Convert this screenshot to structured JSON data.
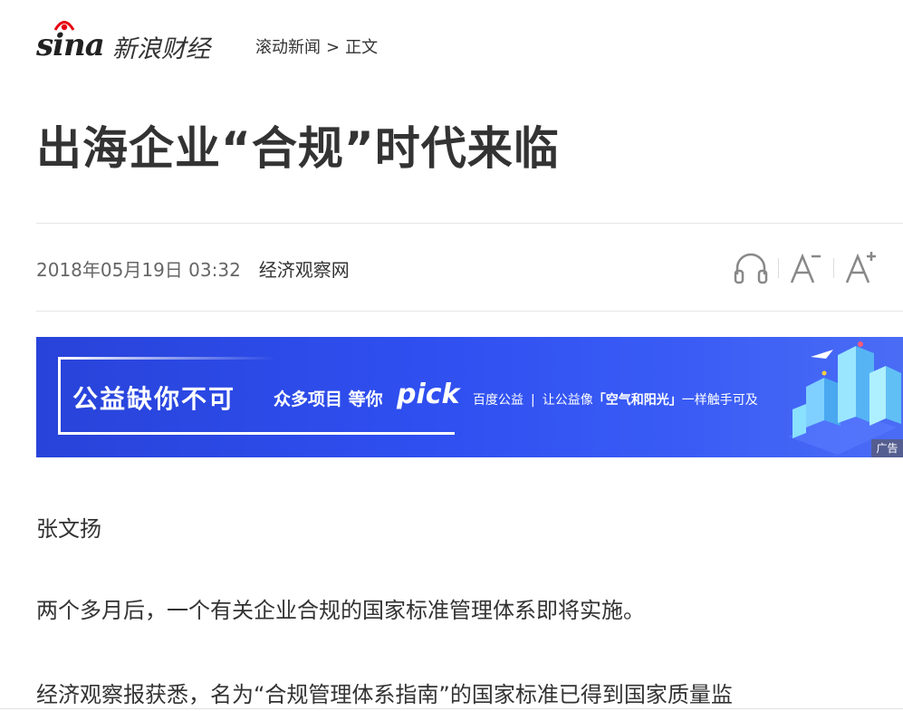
{
  "header": {
    "logo_text": "sina",
    "brand": "新浪财经",
    "breadcrumb": {
      "section": "滚动新闻",
      "separator": ">",
      "current": "正文"
    }
  },
  "article": {
    "title": "出海企业“合规”时代来临",
    "date": "2018年05月19日 03:32",
    "source": "经济观察网",
    "author": "张文扬",
    "paragraphs": [
      "两个多月后，一个有关企业合规的国家标准管理体系即将实施。",
      "经济观察报获悉，名为“合规管理体系指南”的国家标准已得到国家质量监"
    ]
  },
  "tools": [
    {
      "name": "listen",
      "icon": "headphones-icon"
    },
    {
      "name": "font-decrease",
      "icon": "font-decrease-icon"
    },
    {
      "name": "font-increase",
      "icon": "font-increase-icon"
    }
  ],
  "ad": {
    "headline": "公益缺你不可",
    "sub": "众多项目 等你",
    "pick": "pick",
    "partner": "百度公益",
    "bar": "|",
    "slogan_before": "让公益像",
    "slogan_quote": "「空气和阳光」",
    "slogan_after": "一样触手可及",
    "label": "广告"
  },
  "colors": {
    "logo_red": "#e60012",
    "text": "#333333",
    "meta": "#666666",
    "ad_blue": "#2f4ff0"
  }
}
